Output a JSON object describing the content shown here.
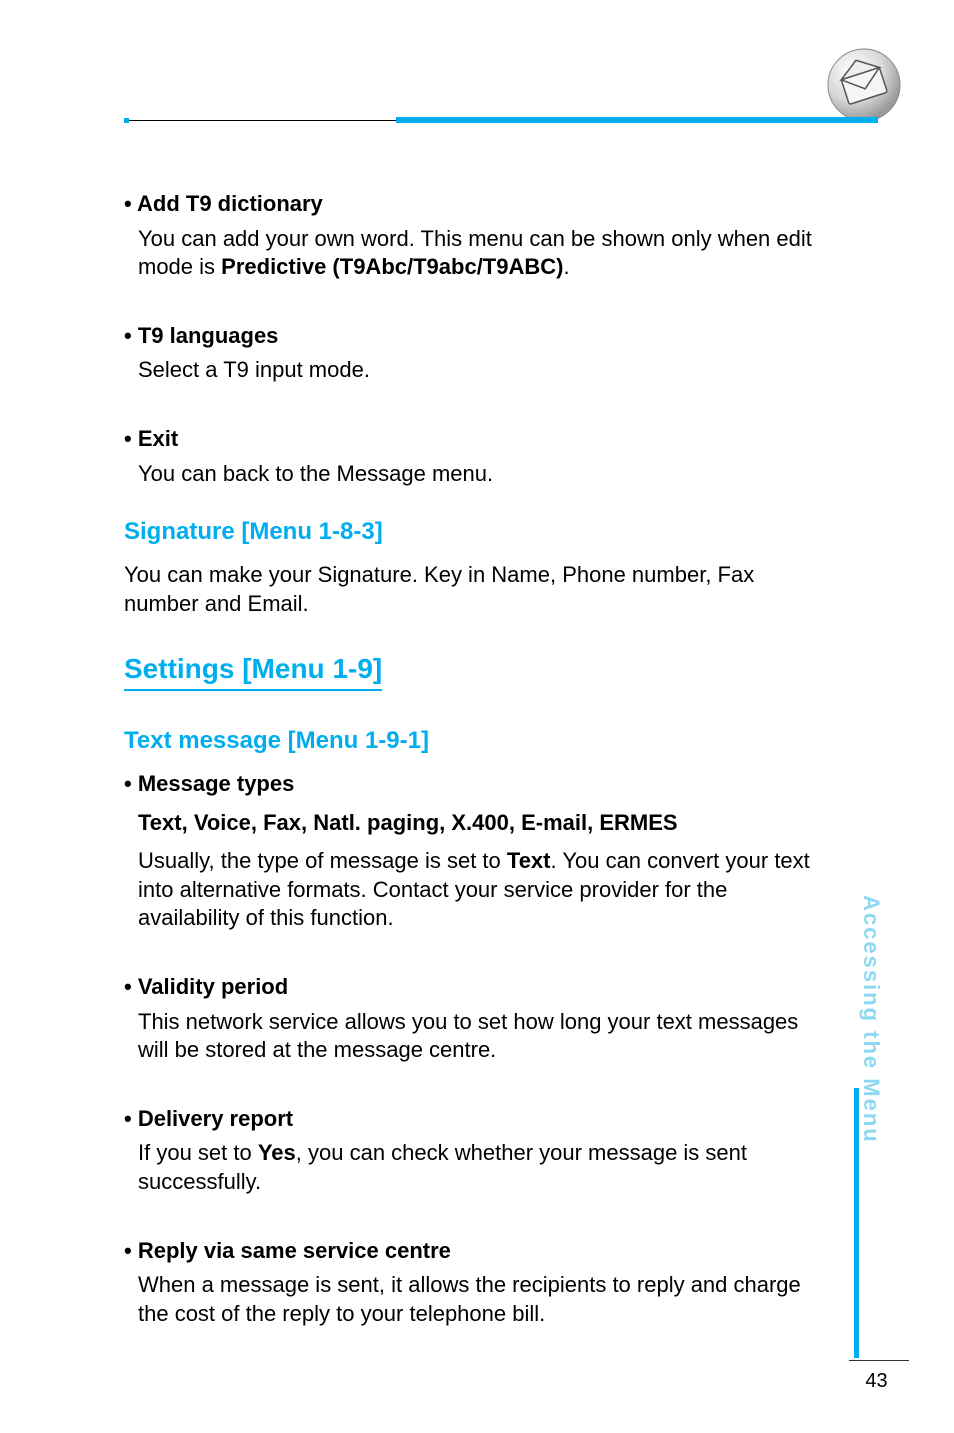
{
  "side_label": "Accessing the Menu",
  "page_number": "43",
  "sections": {
    "add_t9": {
      "title": "• Add T9 dictionary",
      "body_pre": "You can add your own word. This menu can be shown only when edit mode is ",
      "body_bold": "Predictive (T9Abc/T9abc/T9ABC)",
      "body_post": "."
    },
    "t9_lang": {
      "title": "• T9 languages",
      "body": "Select a T9 input mode."
    },
    "exit": {
      "title": "• Exit",
      "body": "You can back to the Message menu."
    },
    "signature": {
      "heading": "Signature [Menu 1-8-3]",
      "body": "You can make your Signature. Key in Name, Phone number, Fax number and Email."
    },
    "settings": {
      "heading": "Settings [Menu 1-9]"
    },
    "text_msg": {
      "heading": "Text message [Menu 1-9-1]"
    },
    "msg_types": {
      "title": "• Message types",
      "subhead": "Text, Voice, Fax, Natl. paging, X.400, E-mail, ERMES",
      "body_pre": "Usually, the type of message is set to ",
      "body_bold": "Text",
      "body_post": ". You can convert your text into alternative formats. Contact your service provider for the availability of this function."
    },
    "validity": {
      "title": "• Validity period",
      "body": "This network service allows you to set how long your text messages will be stored at the message centre."
    },
    "delivery": {
      "title": "• Delivery report",
      "body_pre": "If you set to ",
      "body_bold": "Yes",
      "body_post": ", you can check whether your message is sent successfully."
    },
    "reply": {
      "title": "• Reply via same service centre",
      "body": "When a message is sent, it allows the recipients to reply and charge the cost of the reply to your telephone bill."
    }
  }
}
